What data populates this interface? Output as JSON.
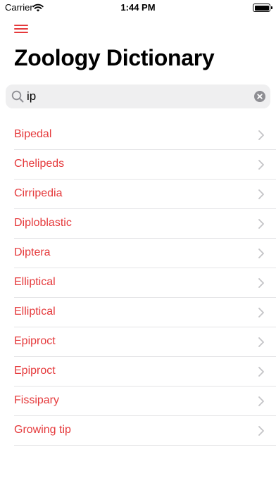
{
  "status_bar": {
    "carrier": "Carrier",
    "time": "1:44 PM"
  },
  "header": {
    "menu_icon": "hamburger-menu-icon",
    "title": "Zoology Dictionary",
    "accent_color": "#e5393b"
  },
  "search": {
    "value": "ip",
    "placeholder": "Search",
    "icon": "magnifying-glass-icon",
    "clear_icon": "clear-x-icon"
  },
  "terms": [
    "Bipedal",
    "Chelipeds",
    "Cirripedia",
    "Diploblastic",
    "Diptera",
    "Elliptical",
    "Elliptical",
    "Epiproct",
    "Epiproct",
    "Fissipary",
    "Growing tip"
  ]
}
